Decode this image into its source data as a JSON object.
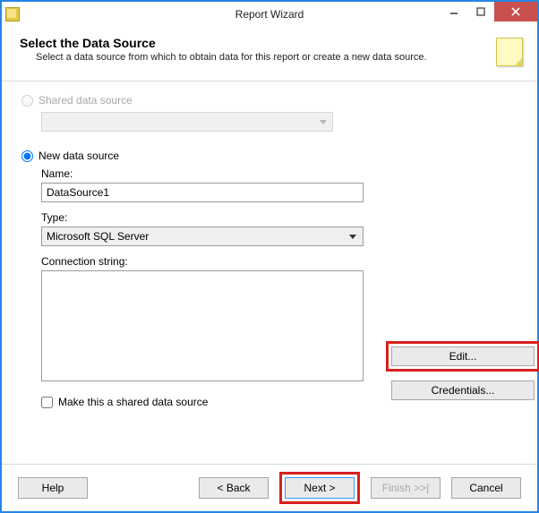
{
  "window": {
    "title": "Report Wizard"
  },
  "header": {
    "title": "Select the Data Source",
    "subtitle": "Select a data source from which to obtain data for this report or create a new data source."
  },
  "shared": {
    "radio_label": "Shared data source",
    "selected": false,
    "enabled": false
  },
  "newsrc": {
    "radio_label": "New data source",
    "selected": true,
    "name_label": "Name:",
    "name_value": "DataSource1",
    "type_label": "Type:",
    "type_value": "Microsoft SQL Server",
    "conn_label": "Connection string:",
    "conn_value": "",
    "make_shared_label": "Make this a shared data source",
    "make_shared_checked": false
  },
  "side": {
    "edit": "Edit...",
    "credentials": "Credentials..."
  },
  "footer": {
    "help": "Help",
    "back": "< Back",
    "next": "Next >",
    "finish": "Finish >>|",
    "cancel": "Cancel"
  }
}
